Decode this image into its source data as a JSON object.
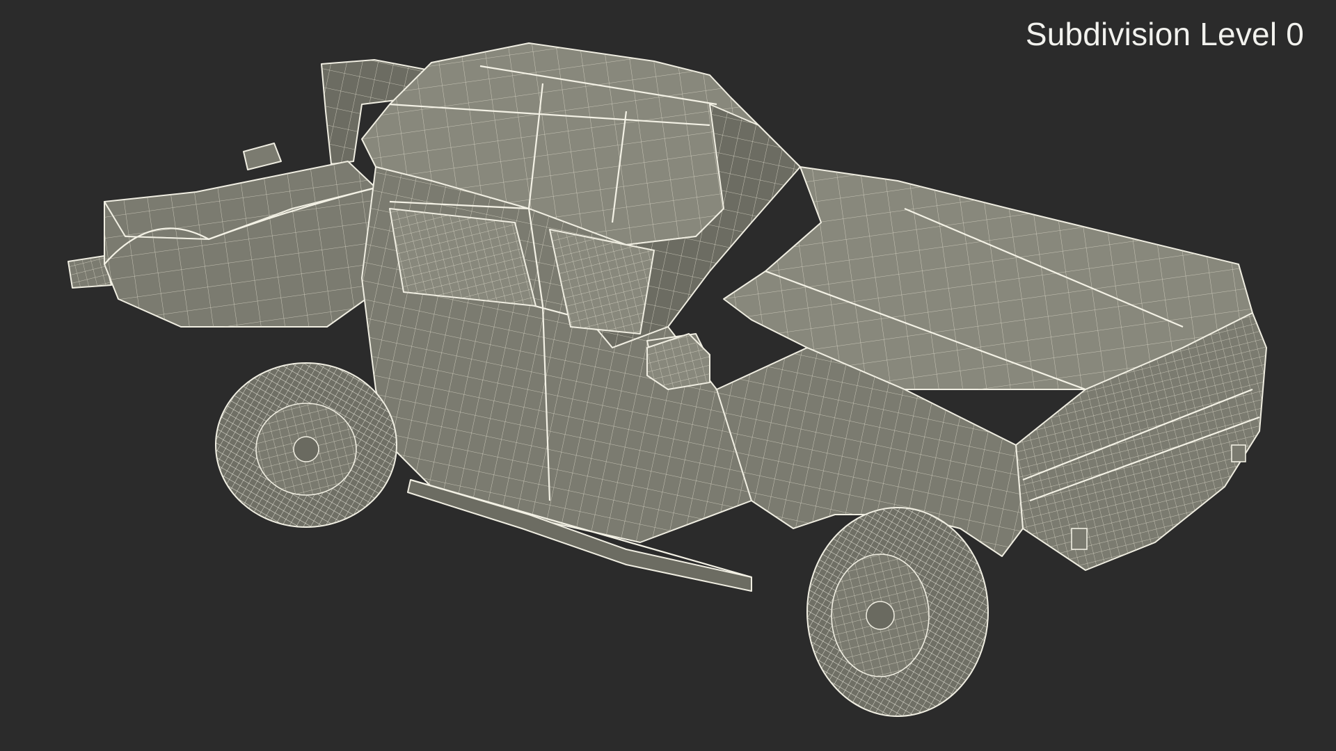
{
  "overlay": {
    "label": "Subdivision Level 0"
  },
  "model": {
    "icon": "wireframe-pickup-truck",
    "background_color": "#2b2b2b",
    "mesh_fill_color": "#7b7b70",
    "wire_color": "#e9e6d8"
  }
}
